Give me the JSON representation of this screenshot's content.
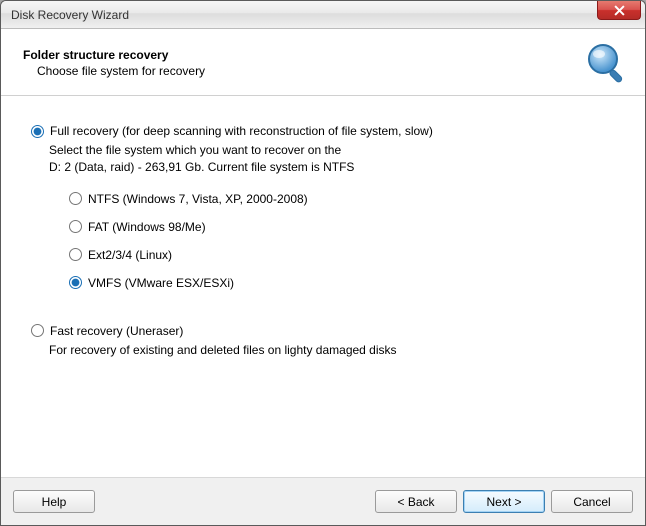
{
  "window": {
    "title": "Disk Recovery Wizard"
  },
  "header": {
    "title": "Folder structure recovery",
    "subtitle": "Choose file system for recovery"
  },
  "full": {
    "label": "Full recovery (for deep scanning with reconstruction of file system, slow)",
    "desc1": "Select the file system which you want to recover on the",
    "desc2": "D: 2 (Data, raid) - 263,91 Gb. Current file system is NTFS",
    "selected": true
  },
  "filesystems": [
    {
      "label": "NTFS (Windows 7, Vista, XP, 2000-2008)",
      "selected": false
    },
    {
      "label": "FAT (Windows 98/Me)",
      "selected": false
    },
    {
      "label": "Ext2/3/4 (Linux)",
      "selected": false
    },
    {
      "label": "VMFS (VMware ESX/ESXi)",
      "selected": true
    }
  ],
  "fast": {
    "label": "Fast recovery (Uneraser)",
    "desc": "For recovery of existing and deleted files on lighty damaged disks",
    "selected": false
  },
  "footer": {
    "help": "Help",
    "back": "< Back",
    "next": "Next >",
    "cancel": "Cancel"
  }
}
